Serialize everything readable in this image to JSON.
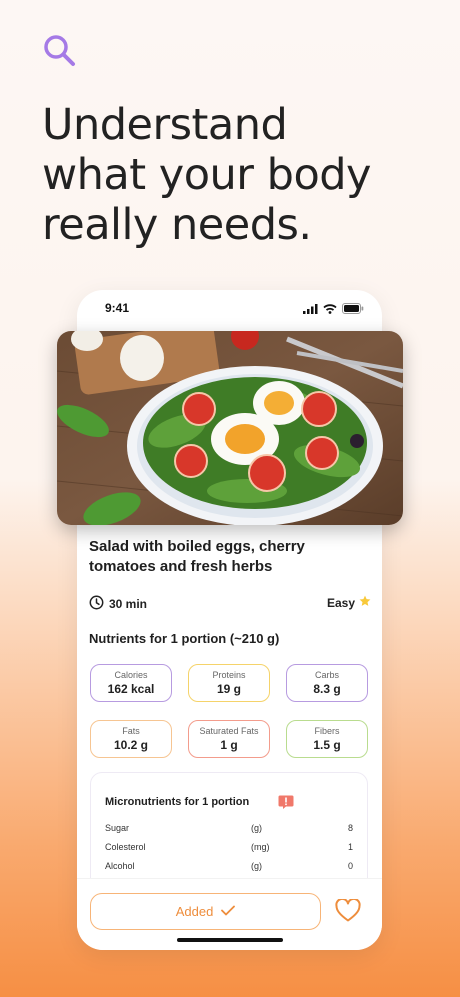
{
  "headline": [
    "Understand",
    "what your body",
    "really needs."
  ],
  "status_bar": {
    "time": "9:41"
  },
  "recipe": {
    "title": "Salad with boiled eggs, cherry tomatoes and fresh herbs",
    "time": "30 min",
    "difficulty": "Easy"
  },
  "nutrients": {
    "title": "Nutrients for 1 portion (~210 g)",
    "tiles": [
      {
        "label": "Calories",
        "value": "162 kcal",
        "color": "#b79be0"
      },
      {
        "label": "Proteins",
        "value": "19 g",
        "color": "#f5d36a"
      },
      {
        "label": "Carbs",
        "value": "8.3 g",
        "color": "#b79be0"
      },
      {
        "label": "Fats",
        "value": "10.2 g",
        "color": "#f6c592"
      },
      {
        "label": "Saturated Fats",
        "value": "1 g",
        "color": "#f39c8c"
      },
      {
        "label": "Fibers",
        "value": "1.5 g",
        "color": "#b9dc8f"
      }
    ]
  },
  "micronutrients": {
    "title": "Micronutrients for 1 portion",
    "rows": [
      {
        "name": "Sugar",
        "unit": "(g)",
        "value": "8"
      },
      {
        "name": "Colesterol",
        "unit": "(mg)",
        "value": "1"
      },
      {
        "name": "Alcohol",
        "unit": "(g)",
        "value": "0"
      }
    ]
  },
  "actions": {
    "added_label": "Added"
  },
  "colors": {
    "accent": "#ee8d3c",
    "search_icon": "#a57ae6"
  }
}
